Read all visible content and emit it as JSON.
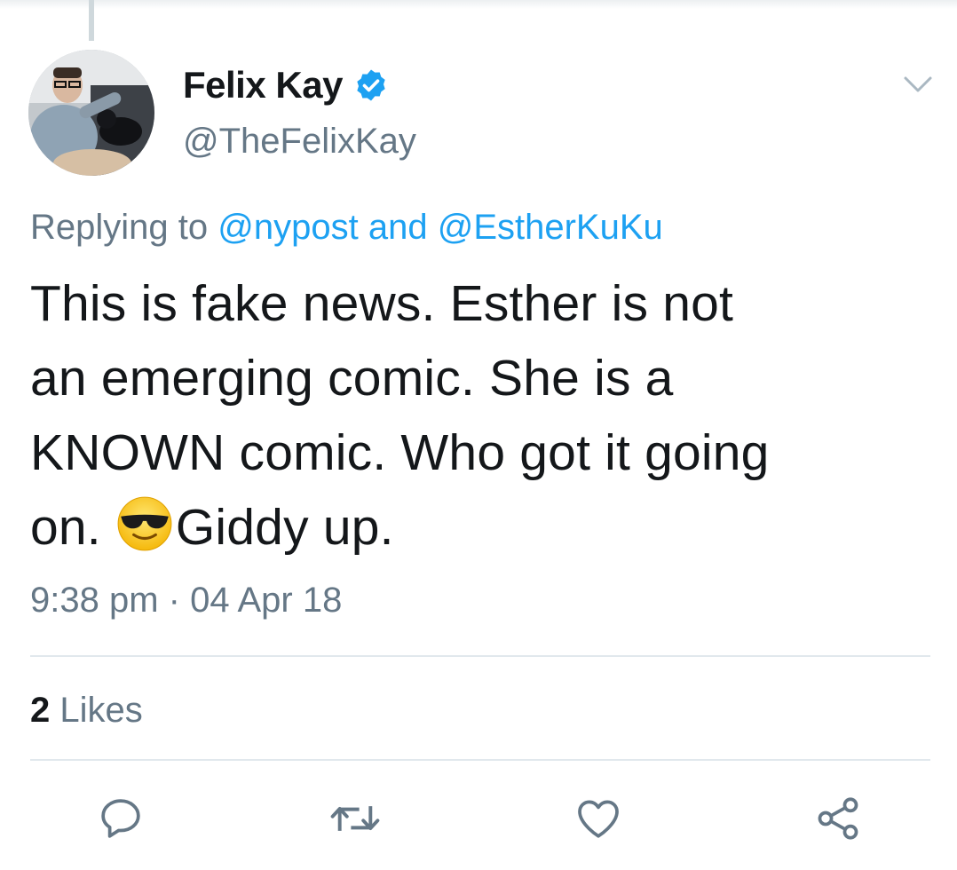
{
  "tweet": {
    "author": {
      "display_name": "Felix Kay",
      "handle": "@TheFelixKay",
      "verified": true,
      "avatar_icon": "user-avatar-photo"
    },
    "reply_context": {
      "prefix": "Replying to",
      "mention_1": "@nypost",
      "conjunction": "and",
      "mention_2": "@EstherKuKu"
    },
    "text": {
      "line_1": "This is fake news. Esther is not",
      "line_2": "an emerging comic. She is a",
      "line_3": "KNOWN comic. Who got it going",
      "line_4_before_emoji": "on. ",
      "line_4_emoji": "smiling-face-with-sunglasses",
      "line_4_after_emoji": "Giddy up."
    },
    "timestamp": "9:38 pm · 04 Apr 18",
    "stats": {
      "likes_count": "2",
      "likes_label": "Likes"
    },
    "actions": {
      "reply_icon": "reply-icon",
      "retweet_icon": "retweet-icon",
      "like_icon": "heart-icon",
      "share_icon": "share-icon"
    }
  },
  "colors": {
    "text_primary": "#14171a",
    "text_secondary": "#657786",
    "link_blue": "#1da1f2",
    "divider": "#e1e8ed",
    "icon_gray": "#657786"
  }
}
